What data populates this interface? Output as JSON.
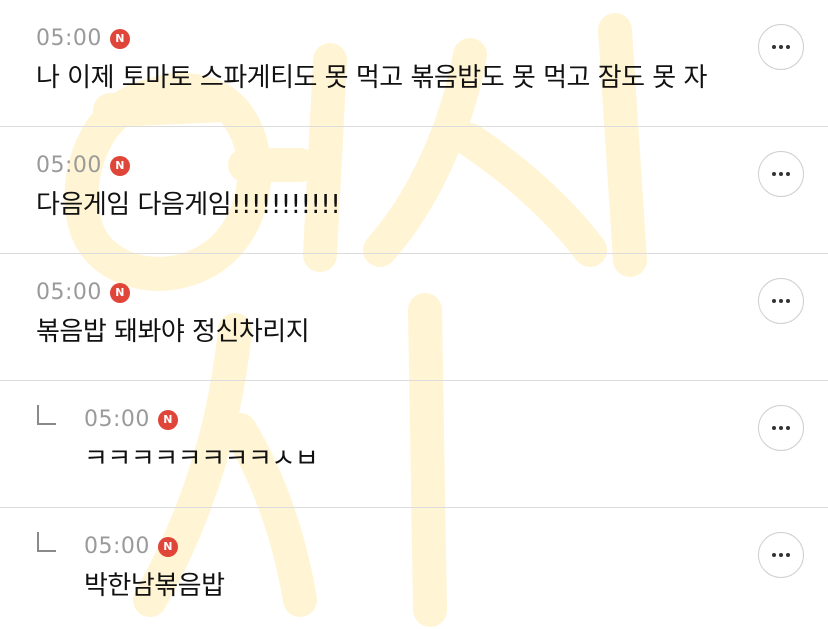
{
  "comments": [
    {
      "time": "05:00",
      "badge": "N",
      "text": "나 이제 토마토 스파게티도 못 먹고 볶음밥도 못 먹고 잠도 못 자",
      "is_reply": false
    },
    {
      "time": "05:00",
      "badge": "N",
      "text": "다음게임 다음게임!!!!!!!!!!!",
      "is_reply": false
    },
    {
      "time": "05:00",
      "badge": "N",
      "text": "볶음밥 돼봐야 정신차리지",
      "is_reply": false
    },
    {
      "time": "05:00",
      "badge": "N",
      "text": "ㅋㅋㅋㅋㅋㅋㅋㅋㅅㅂ",
      "is_reply": true
    },
    {
      "time": "05:00",
      "badge": "N",
      "text": "박한남볶음밥",
      "is_reply": true
    }
  ],
  "icons": {
    "more": "more-horizontal-icon",
    "reply": "reply-arrow-icon"
  },
  "colors": {
    "new_badge": "#e0453a",
    "time_text": "#9a9a9a",
    "watermark": "#fff3cf",
    "divider": "#dcdcdc"
  }
}
